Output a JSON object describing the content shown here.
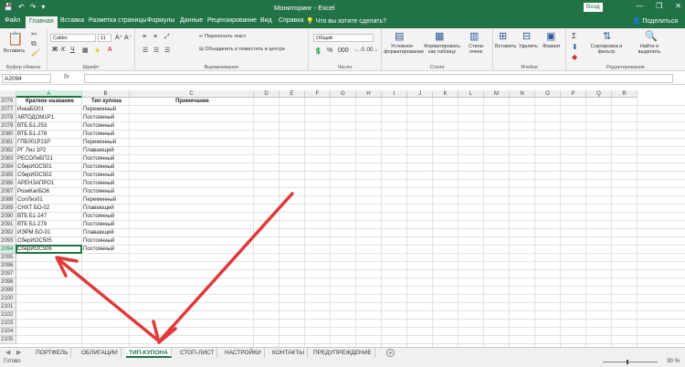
{
  "titlebar": {
    "title": "Мониторинг - Excel",
    "signin": "Вход",
    "min": "—",
    "restore": "❐",
    "close": "✕"
  },
  "tabs": [
    "Файл",
    "Главная",
    "Вставка",
    "Разметка страницы",
    "Формулы",
    "Данные",
    "Рецензирование",
    "Вид",
    "Справка",
    "Что вы хотите сделать?"
  ],
  "share_label": "Поделиться",
  "ribbon": {
    "clipboard": {
      "paste": "Вставить",
      "label": "Буфер обмена"
    },
    "font": {
      "name": "Calibri",
      "size": "11",
      "label": "Шрифт",
      "bold": "Ж",
      "italic": "К",
      "underline": "Ч"
    },
    "alignment": {
      "wrap": "Переносить текст",
      "merge": "Объединить и поместить в центре",
      "label": "Выравнивание"
    },
    "number": {
      "format": "Общий",
      "label": "Число"
    },
    "styles": {
      "conditional": "Условное форматирование",
      "table": "Форматировать как таблицу",
      "cell_styles": "Стили ячеек",
      "label": "Стили"
    },
    "cells": {
      "insert": "Вставить",
      "delete": "Удалить",
      "format": "Формат",
      "label": "Ячейки"
    },
    "editing": {
      "sort": "Сортировка и фильтр",
      "find": "Найти и выделить",
      "label": "Редактирование"
    }
  },
  "formula_bar": {
    "name_box": "A2094",
    "fx": "fx",
    "value": ""
  },
  "columns": [
    "A",
    "B",
    "C",
    "D",
    "E",
    "F",
    "G",
    "H",
    "I",
    "J",
    "K",
    "L",
    "M",
    "N",
    "O",
    "P",
    "Q",
    "R"
  ],
  "row_numbers": [
    "2076",
    "2077",
    "2078",
    "2079",
    "2080",
    "2081",
    "2082",
    "2083",
    "2084",
    "2085",
    "2086",
    "2087",
    "2088",
    "2089",
    "2090",
    "2091",
    "2092",
    "2093",
    "2094",
    "2095",
    "2096",
    "2097",
    "2098",
    "2099",
    "2100",
    "2101",
    "2102",
    "2103",
    "2104",
    "2105"
  ],
  "header_row": {
    "a": "Краткое название",
    "b": "Тип купона",
    "c": "Примечание"
  },
  "rows": [
    {
      "a": "ИнкаБО01",
      "b": "Переменный"
    },
    {
      "a": "АВТОДОМ1Р1",
      "b": "Постоянный"
    },
    {
      "a": "ВТБ Б1-253",
      "b": "Постоянный"
    },
    {
      "a": "ВТБ Б1-278",
      "b": "Постоянный"
    },
    {
      "a": "ГПБ001Р21Р",
      "b": "Переменный"
    },
    {
      "a": "РГ Лиз 1Р2",
      "b": "Плавающий"
    },
    {
      "a": "РЕСОЛиБП21",
      "b": "Постоянный"
    },
    {
      "a": "СберИОС501",
      "b": "Постоянный"
    },
    {
      "a": "СберИОС502",
      "b": "Постоянный"
    },
    {
      "a": "АРЕНЗАПРО1",
      "b": "Постоянный"
    },
    {
      "a": "РозиКапБО6",
      "b": "Постоянный"
    },
    {
      "a": "СолЛиз01",
      "b": "Переменный"
    },
    {
      "a": "СНХТ БО-02",
      "b": "Плавающий"
    },
    {
      "a": "ВТБ Б1-247",
      "b": "Постоянный"
    },
    {
      "a": "ВТБ Б1-279",
      "b": "Постоянный"
    },
    {
      "a": "ИЭРМ БО-01",
      "b": "Плавающий"
    },
    {
      "a": "СберИОС505",
      "b": "Постоянный"
    },
    {
      "a": "СберИОС506",
      "b": "Постоянный"
    }
  ],
  "sheet_tabs": [
    "ПОРТФЕЛЬ",
    "ОБЛИГАЦИИ",
    "ТИП-КУПОНА",
    "СТОП-ЛИСТ",
    "НАСТРОЙКИ",
    "КОНТАКТЫ",
    "ПРЕДУПРЕЖДЕНИЕ"
  ],
  "active_sheet": "ТИП-КУПОНА",
  "status": {
    "ready": "Готово",
    "zoom": "90 %"
  },
  "colors": {
    "excel_green": "#217346",
    "arrow_red": "#e03a3a"
  }
}
